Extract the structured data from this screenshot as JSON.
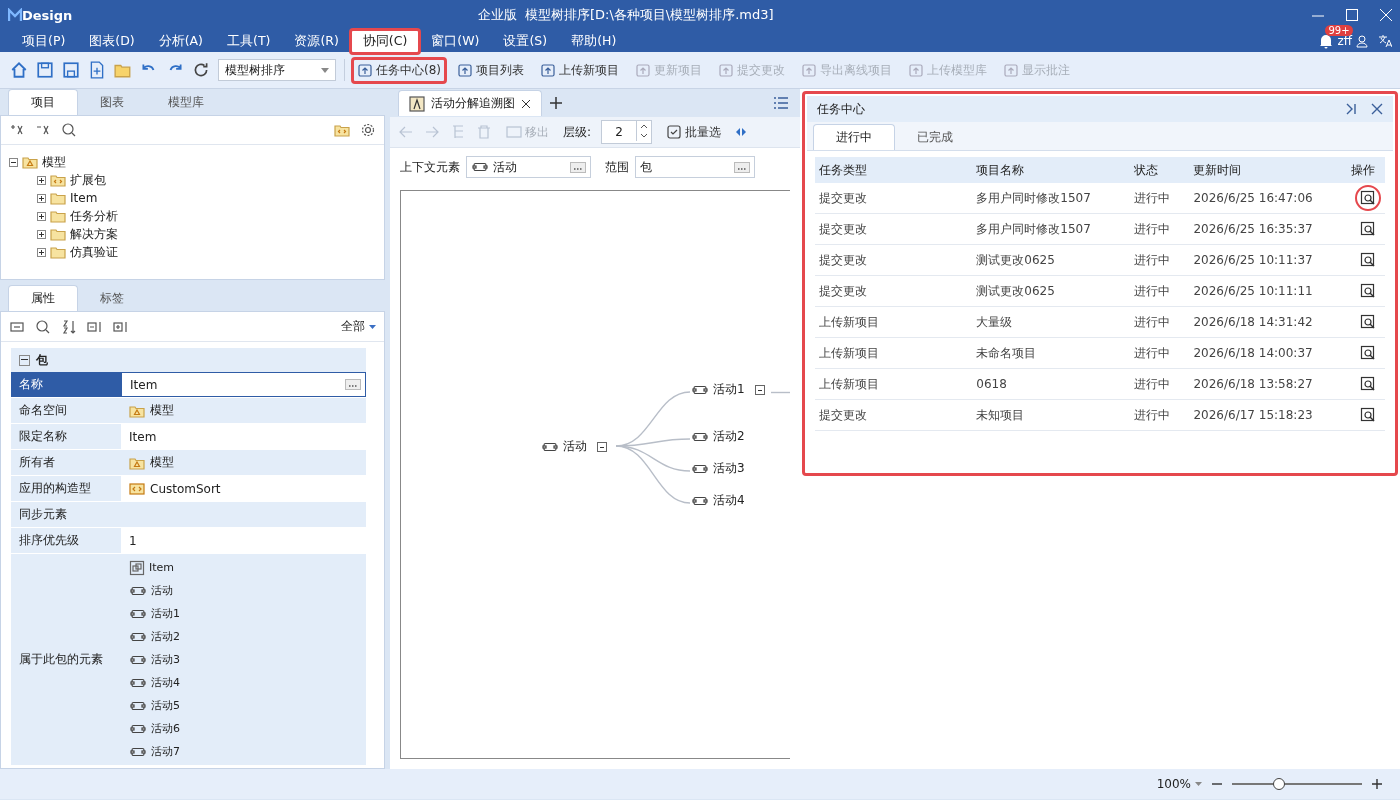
{
  "window": {
    "logo": "Design",
    "edition": "企业版",
    "title": "模型树排序[D:\\各种项目\\模型树排序.md3]"
  },
  "menu": [
    {
      "label": "项目(P)",
      "highlighted": false
    },
    {
      "label": "图表(D)",
      "highlighted": false
    },
    {
      "label": "分析(A)",
      "highlighted": false
    },
    {
      "label": "工具(T)",
      "highlighted": false
    },
    {
      "label": "资源(R)",
      "highlighted": false
    },
    {
      "label": "协同(C)",
      "highlighted": true
    },
    {
      "label": "窗口(W)",
      "highlighted": false
    },
    {
      "label": "设置(S)",
      "highlighted": false
    },
    {
      "label": "帮助(H)",
      "highlighted": false
    }
  ],
  "account": {
    "badge": "99+",
    "user": "zff"
  },
  "toolbar": {
    "project_select": "模型树排序",
    "actions": [
      {
        "label": "任务中心(8)",
        "disabled": false,
        "highlighted": true
      },
      {
        "label": "项目列表",
        "disabled": false,
        "highlighted": false
      },
      {
        "label": "上传新项目",
        "disabled": false,
        "highlighted": false
      },
      {
        "label": "更新项目",
        "disabled": true,
        "highlighted": false
      },
      {
        "label": "提交更改",
        "disabled": true,
        "highlighted": false
      },
      {
        "label": "导出离线项目",
        "disabled": true,
        "highlighted": false
      },
      {
        "label": "上传模型库",
        "disabled": true,
        "highlighted": false
      },
      {
        "label": "显示批注",
        "disabled": true,
        "highlighted": false
      }
    ]
  },
  "project_panel": {
    "tabs": [
      {
        "label": "项目",
        "selected": true
      },
      {
        "label": "图表",
        "selected": false
      },
      {
        "label": "模型库",
        "selected": false
      }
    ],
    "tree": [
      {
        "label": "模型",
        "kind": "model",
        "expanded": true,
        "children": [
          {
            "label": "扩展包",
            "kind": "profile",
            "expanded": false
          },
          {
            "label": "Item",
            "kind": "folder",
            "expanded": false
          },
          {
            "label": "任务分析",
            "kind": "folder",
            "expanded": false
          },
          {
            "label": "解决方案",
            "kind": "folder",
            "expanded": false
          },
          {
            "label": "仿真验证",
            "kind": "folder",
            "expanded": false
          }
        ]
      }
    ]
  },
  "properties_panel": {
    "tabs": [
      {
        "label": "属性",
        "selected": true
      },
      {
        "label": "标签",
        "selected": false
      }
    ],
    "filter": "全部",
    "group": {
      "label": "包",
      "expanded": true
    },
    "rows": [
      {
        "name": "名称",
        "kind": "edit",
        "value": "Item",
        "selected": true
      },
      {
        "name": "命名空间",
        "kind": "model",
        "value": "模型",
        "selected": false
      },
      {
        "name": "限定名称",
        "kind": "text",
        "value": "Item",
        "selected": false
      },
      {
        "name": "所有者",
        "kind": "model",
        "value": "模型",
        "selected": false
      },
      {
        "name": "应用的构造型",
        "kind": "stereotype",
        "value": "CustomSort",
        "selected": false
      },
      {
        "name": "同步元素",
        "kind": "empty",
        "selected": false
      },
      {
        "name": "排序优先级",
        "kind": "text",
        "value": "1",
        "selected": false
      },
      {
        "name": "属于此包的元素",
        "kind": "list",
        "selected": false,
        "items": [
          {
            "label": "Item",
            "kind": "diagram"
          },
          {
            "label": "活动",
            "kind": "activity"
          },
          {
            "label": "活动1",
            "kind": "activity"
          },
          {
            "label": "活动2",
            "kind": "activity"
          },
          {
            "label": "活动3",
            "kind": "activity"
          },
          {
            "label": "活动4",
            "kind": "activity"
          },
          {
            "label": "活动5",
            "kind": "activity"
          },
          {
            "label": "活动6",
            "kind": "activity"
          },
          {
            "label": "活动7",
            "kind": "activity"
          }
        ]
      }
    ]
  },
  "editor": {
    "tabs": [
      {
        "label": "活动分解追溯图",
        "selected": true
      }
    ],
    "toolbar": {
      "remove": "移出",
      "level_label": "层级:",
      "level_value": "2",
      "batch_select": "批量选"
    },
    "context_label": "上下文元素",
    "context_value": "活动",
    "scope_label": "范围",
    "scope_value": "包",
    "diagram": {
      "root": {
        "label": "活动",
        "collapsible": true
      },
      "children": [
        {
          "label": "活动1",
          "collapsible": true
        },
        {
          "label": "活动2",
          "collapsible": false
        },
        {
          "label": "活动3",
          "collapsible": false
        },
        {
          "label": "活动4",
          "collapsible": false
        }
      ]
    }
  },
  "task_center": {
    "title": "任务中心",
    "highlighted": true,
    "tabs": [
      {
        "label": "进行中",
        "selected": true
      },
      {
        "label": "已完成",
        "selected": false
      }
    ],
    "columns": [
      "任务类型",
      "项目名称",
      "状态",
      "更新时间",
      "操作"
    ],
    "rows": [
      {
        "type": "提交更改",
        "project": "多用户同时修改1507",
        "status": "进行中",
        "time": "2026/6/25 16:47:06",
        "highlighted": true
      },
      {
        "type": "提交更改",
        "project": "多用户同时修改1507",
        "status": "进行中",
        "time": "2026/6/25 16:35:37",
        "highlighted": false
      },
      {
        "type": "提交更改",
        "project": "测试更改0625",
        "status": "进行中",
        "time": "2026/6/25 10:11:37",
        "highlighted": false
      },
      {
        "type": "提交更改",
        "project": "测试更改0625",
        "status": "进行中",
        "time": "2026/6/25 10:11:11",
        "highlighted": false
      },
      {
        "type": "上传新项目",
        "project": "大量级",
        "status": "进行中",
        "time": "2026/6/18 14:31:42",
        "highlighted": false
      },
      {
        "type": "上传新项目",
        "project": "未命名项目",
        "status": "进行中",
        "time": "2026/6/18 14:00:37",
        "highlighted": false
      },
      {
        "type": "上传新项目",
        "project": "0618",
        "status": "进行中",
        "time": "2026/6/18 13:58:27",
        "highlighted": false
      },
      {
        "type": "提交更改",
        "project": "未知项目",
        "status": "进行中",
        "time": "2026/6/17 15:18:23",
        "highlighted": false
      }
    ]
  },
  "status_bar": {
    "zoom": "100%",
    "slider": {
      "level": 0.36
    }
  }
}
